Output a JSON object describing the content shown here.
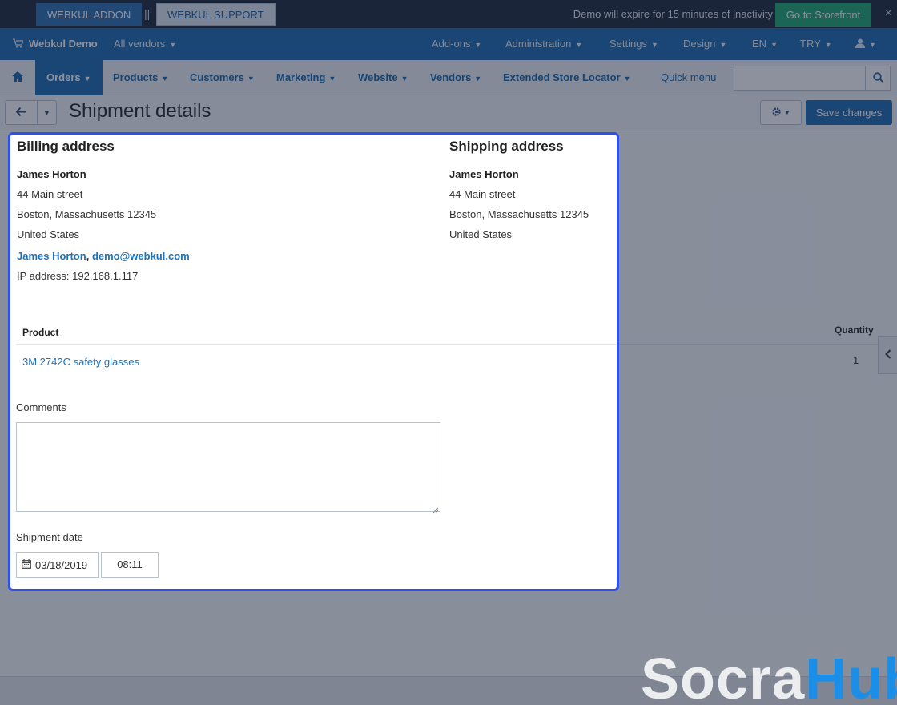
{
  "topbar": {
    "addon_label": "WEBKUL ADDON",
    "separator": "||",
    "support_label": "WEBKUL SUPPORT",
    "demo_notice": "Demo will expire for 15 minutes of inactivity",
    "storefront_label": "Go to Storefront",
    "close": "×"
  },
  "adminbar": {
    "brand": "Webkul Demo",
    "vendors": "All vendors",
    "addons": "Add-ons",
    "administration": "Administration",
    "settings": "Settings",
    "design": "Design",
    "language": "EN",
    "currency": "TRY"
  },
  "mainnav": {
    "items": [
      "Orders",
      "Products",
      "Customers",
      "Marketing",
      "Website",
      "Vendors",
      "Extended Store Locator"
    ],
    "quick_menu": "Quick menu",
    "search_placeholder": ""
  },
  "page": {
    "title": "Shipment details",
    "save_label": "Save changes"
  },
  "background": {
    "quantity_header": "Quantity",
    "quantity_value": "1"
  },
  "popup": {
    "billing": {
      "title": "Billing address",
      "name": "James Horton",
      "street": "44 Main street",
      "city": "Boston, Massachusetts 12345",
      "country": "United States",
      "contact_name": "James Horton",
      "contact_sep": ", ",
      "email": "demo@webkul.com",
      "ip": "IP address: 192.168.1.117"
    },
    "shipping": {
      "title": "Shipping address",
      "name": "James Horton",
      "street": "44 Main street",
      "city": "Boston, Massachusetts 12345",
      "country": "United States"
    },
    "table": {
      "product_header": "Product",
      "product_name": "3M 2742C safety glasses"
    },
    "comments_label": "Comments",
    "comments_value": "",
    "shipment_date_label": "Shipment date",
    "date_value": "03/18/2019",
    "time_value": "08:11"
  },
  "watermark": {
    "part1": "Socra",
    "part2": "Hub"
  },
  "colors": {
    "admin_bar": "#1a68b0",
    "popup_border": "#2e50e8",
    "link": "#1a73c0",
    "storefront": "#1ba66c"
  }
}
